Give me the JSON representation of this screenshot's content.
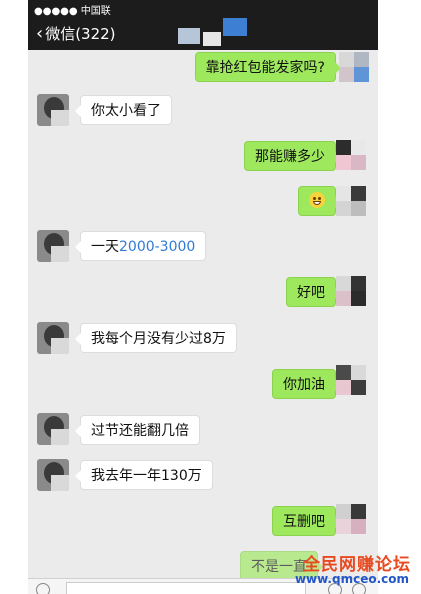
{
  "status_bar": {
    "carrier": "●●●●● 中国联"
  },
  "nav_bar": {
    "back_label": "微信(322)",
    "back_chevron": "‹"
  },
  "messages": [
    {
      "side": "right",
      "text": "靠抢红包能发家吗?"
    },
    {
      "side": "left",
      "text": "你太小看了"
    },
    {
      "side": "right",
      "text": "那能赚多少"
    },
    {
      "side": "right",
      "emoji": "grinning-face-icon"
    },
    {
      "side": "left",
      "prefix": "一天",
      "number": "2000-3000"
    },
    {
      "side": "right",
      "text": "好吧"
    },
    {
      "side": "left",
      "text": "我每个月没有少过8万"
    },
    {
      "side": "right",
      "text": "你加油"
    },
    {
      "side": "left",
      "text": "过节还能翻几倍"
    },
    {
      "side": "left",
      "text": "我去年一年130万"
    },
    {
      "side": "right",
      "text": "互删吧"
    },
    {
      "side": "right",
      "text": "不是一直"
    }
  ],
  "watermark": {
    "title": "全民网赚论坛",
    "url": "www.qmceo.com"
  },
  "colors": {
    "out_bubble": "#9ee85e",
    "number_text": "#2f7bd5",
    "header": "#1c1c1c"
  }
}
